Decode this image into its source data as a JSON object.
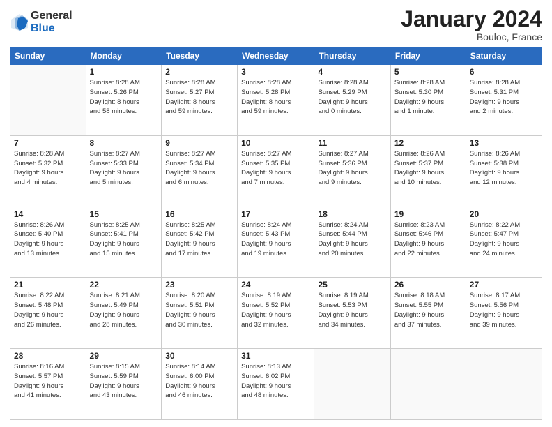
{
  "header": {
    "logo_general": "General",
    "logo_blue": "Blue",
    "month_title": "January 2024",
    "location": "Bouloc, France"
  },
  "days_of_week": [
    "Sunday",
    "Monday",
    "Tuesday",
    "Wednesday",
    "Thursday",
    "Friday",
    "Saturday"
  ],
  "weeks": [
    [
      {
        "day": "",
        "info": ""
      },
      {
        "day": "1",
        "info": "Sunrise: 8:28 AM\nSunset: 5:26 PM\nDaylight: 8 hours\nand 58 minutes."
      },
      {
        "day": "2",
        "info": "Sunrise: 8:28 AM\nSunset: 5:27 PM\nDaylight: 8 hours\nand 59 minutes."
      },
      {
        "day": "3",
        "info": "Sunrise: 8:28 AM\nSunset: 5:28 PM\nDaylight: 8 hours\nand 59 minutes."
      },
      {
        "day": "4",
        "info": "Sunrise: 8:28 AM\nSunset: 5:29 PM\nDaylight: 9 hours\nand 0 minutes."
      },
      {
        "day": "5",
        "info": "Sunrise: 8:28 AM\nSunset: 5:30 PM\nDaylight: 9 hours\nand 1 minute."
      },
      {
        "day": "6",
        "info": "Sunrise: 8:28 AM\nSunset: 5:31 PM\nDaylight: 9 hours\nand 2 minutes."
      }
    ],
    [
      {
        "day": "7",
        "info": "Sunrise: 8:28 AM\nSunset: 5:32 PM\nDaylight: 9 hours\nand 4 minutes."
      },
      {
        "day": "8",
        "info": "Sunrise: 8:27 AM\nSunset: 5:33 PM\nDaylight: 9 hours\nand 5 minutes."
      },
      {
        "day": "9",
        "info": "Sunrise: 8:27 AM\nSunset: 5:34 PM\nDaylight: 9 hours\nand 6 minutes."
      },
      {
        "day": "10",
        "info": "Sunrise: 8:27 AM\nSunset: 5:35 PM\nDaylight: 9 hours\nand 7 minutes."
      },
      {
        "day": "11",
        "info": "Sunrise: 8:27 AM\nSunset: 5:36 PM\nDaylight: 9 hours\nand 9 minutes."
      },
      {
        "day": "12",
        "info": "Sunrise: 8:26 AM\nSunset: 5:37 PM\nDaylight: 9 hours\nand 10 minutes."
      },
      {
        "day": "13",
        "info": "Sunrise: 8:26 AM\nSunset: 5:38 PM\nDaylight: 9 hours\nand 12 minutes."
      }
    ],
    [
      {
        "day": "14",
        "info": "Sunrise: 8:26 AM\nSunset: 5:40 PM\nDaylight: 9 hours\nand 13 minutes."
      },
      {
        "day": "15",
        "info": "Sunrise: 8:25 AM\nSunset: 5:41 PM\nDaylight: 9 hours\nand 15 minutes."
      },
      {
        "day": "16",
        "info": "Sunrise: 8:25 AM\nSunset: 5:42 PM\nDaylight: 9 hours\nand 17 minutes."
      },
      {
        "day": "17",
        "info": "Sunrise: 8:24 AM\nSunset: 5:43 PM\nDaylight: 9 hours\nand 19 minutes."
      },
      {
        "day": "18",
        "info": "Sunrise: 8:24 AM\nSunset: 5:44 PM\nDaylight: 9 hours\nand 20 minutes."
      },
      {
        "day": "19",
        "info": "Sunrise: 8:23 AM\nSunset: 5:46 PM\nDaylight: 9 hours\nand 22 minutes."
      },
      {
        "day": "20",
        "info": "Sunrise: 8:22 AM\nSunset: 5:47 PM\nDaylight: 9 hours\nand 24 minutes."
      }
    ],
    [
      {
        "day": "21",
        "info": "Sunrise: 8:22 AM\nSunset: 5:48 PM\nDaylight: 9 hours\nand 26 minutes."
      },
      {
        "day": "22",
        "info": "Sunrise: 8:21 AM\nSunset: 5:49 PM\nDaylight: 9 hours\nand 28 minutes."
      },
      {
        "day": "23",
        "info": "Sunrise: 8:20 AM\nSunset: 5:51 PM\nDaylight: 9 hours\nand 30 minutes."
      },
      {
        "day": "24",
        "info": "Sunrise: 8:19 AM\nSunset: 5:52 PM\nDaylight: 9 hours\nand 32 minutes."
      },
      {
        "day": "25",
        "info": "Sunrise: 8:19 AM\nSunset: 5:53 PM\nDaylight: 9 hours\nand 34 minutes."
      },
      {
        "day": "26",
        "info": "Sunrise: 8:18 AM\nSunset: 5:55 PM\nDaylight: 9 hours\nand 37 minutes."
      },
      {
        "day": "27",
        "info": "Sunrise: 8:17 AM\nSunset: 5:56 PM\nDaylight: 9 hours\nand 39 minutes."
      }
    ],
    [
      {
        "day": "28",
        "info": "Sunrise: 8:16 AM\nSunset: 5:57 PM\nDaylight: 9 hours\nand 41 minutes."
      },
      {
        "day": "29",
        "info": "Sunrise: 8:15 AM\nSunset: 5:59 PM\nDaylight: 9 hours\nand 43 minutes."
      },
      {
        "day": "30",
        "info": "Sunrise: 8:14 AM\nSunset: 6:00 PM\nDaylight: 9 hours\nand 46 minutes."
      },
      {
        "day": "31",
        "info": "Sunrise: 8:13 AM\nSunset: 6:02 PM\nDaylight: 9 hours\nand 48 minutes."
      },
      {
        "day": "",
        "info": ""
      },
      {
        "day": "",
        "info": ""
      },
      {
        "day": "",
        "info": ""
      }
    ]
  ]
}
